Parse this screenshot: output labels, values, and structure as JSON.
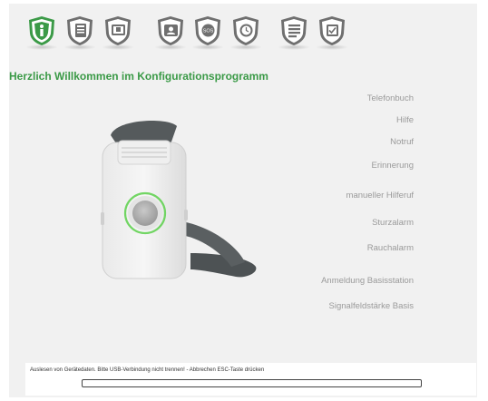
{
  "colors": {
    "accent": "#3b9a47",
    "icon_inactive": "#6f6f6f",
    "menu_text": "#9a9a9a",
    "background": "#f1f1f1"
  },
  "toolbar": {
    "icons": [
      {
        "name": "info-icon",
        "active": true
      },
      {
        "name": "phonebook-icon",
        "active": false
      },
      {
        "name": "contact-card-icon",
        "active": false
      },
      {
        "name": "phone-user-icon",
        "active": false
      },
      {
        "name": "sos-icon",
        "glyph": "SOS",
        "active": false
      },
      {
        "name": "alarm-clock-icon",
        "active": false
      },
      {
        "name": "list-settings-icon",
        "active": false
      },
      {
        "name": "check-document-icon",
        "active": false
      }
    ]
  },
  "welcome_title": "Herzlich Willkommen im Konfigurationsprogramm",
  "menu": {
    "items": [
      "Telefonbuch",
      "Hilfe",
      "Notruf",
      "Erinnerung",
      "manueller Hilferuf",
      "Sturzalarm",
      "Rauchalarm",
      "Anmeldung Basisstation",
      "Signalfeldstärke Basis"
    ]
  },
  "status": {
    "message": "Auslesen von Gerätedaten. Bitte USB-Verbindung nicht trennen! - Abbrechen ESC-Taste drücken",
    "progress": 0
  }
}
